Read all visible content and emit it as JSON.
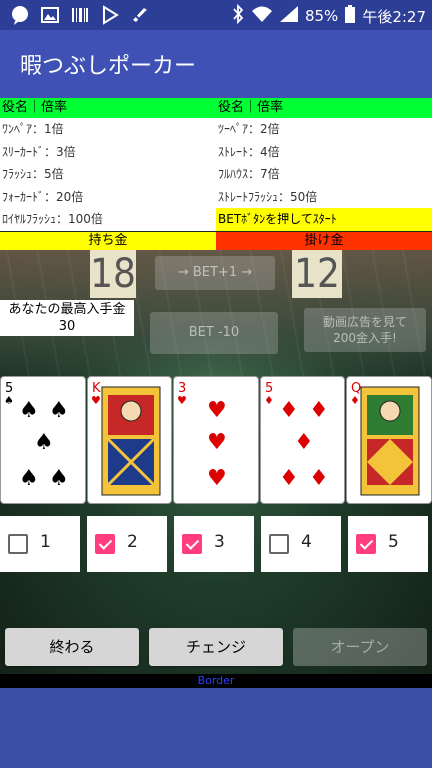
{
  "statusbar": {
    "battery_percent": "85%",
    "time": "午後2:27",
    "left_icons": [
      "chat-icon",
      "image-icon",
      "barcode-icon",
      "play-store-icon",
      "check-icon"
    ],
    "right_icons": [
      "bluetooth-icon",
      "wifi-icon",
      "signal-icon",
      "battery-icon"
    ]
  },
  "app": {
    "title": "暇つぶしポーカー"
  },
  "paytable": {
    "header_left": "役名｜倍率",
    "header_right": "役名｜倍率",
    "left_rows": [
      "ﾜﾝﾍﾟｱ：1倍",
      "ｽﾘｰｶｰﾄﾞ：3倍",
      "ﾌﾗｯｼｭ：5倍",
      "ﾌｫｰｶｰﾄﾞ：20倍",
      "ﾛｲﾔﾙﾌﾗｯｼｭ：100倍"
    ],
    "right_rows": [
      "ﾂｰﾍﾟｱ：2倍",
      "ｽﾄﾚｰﾄ：4倍",
      "ﾌﾙﾊｳｽ：7倍",
      "ｽﾄﾚｰﾄﾌﾗｯｼｭ：50倍"
    ],
    "hint": "BETﾎﾞﾀﾝを押してｽﾀｰﾄ"
  },
  "labels": {
    "held": "持ち金",
    "bet": "掛け金"
  },
  "values": {
    "held": "18",
    "bet": "12"
  },
  "buttons": {
    "bet_plus": "→ BET+1 →",
    "bet_minus10": "BET -10",
    "video": "動画広告を見て\n200金入手!",
    "quit": "終わる",
    "change": "チェンジ",
    "open": "オープン"
  },
  "max_win": {
    "label": "あなたの最高入手金",
    "value": "30"
  },
  "cards": [
    {
      "rank": "5",
      "suit": "spade"
    },
    {
      "rank": "K",
      "suit": "heart"
    },
    {
      "rank": "3",
      "suit": "heart"
    },
    {
      "rank": "5",
      "suit": "diamond"
    },
    {
      "rank": "Q",
      "suit": "diamond"
    }
  ],
  "holds": [
    {
      "num": "1",
      "checked": false
    },
    {
      "num": "2",
      "checked": true
    },
    {
      "num": "3",
      "checked": true
    },
    {
      "num": "4",
      "checked": false
    },
    {
      "num": "5",
      "checked": true
    }
  ],
  "footer": {
    "border_label": "Border"
  },
  "colors": {
    "appbar": "#3f51b5",
    "statusbar": "#2c3e96",
    "header_green": "#00ff33",
    "yellow": "#ffff00",
    "red": "#ff3300",
    "check_pink": "#ff3d7f"
  }
}
